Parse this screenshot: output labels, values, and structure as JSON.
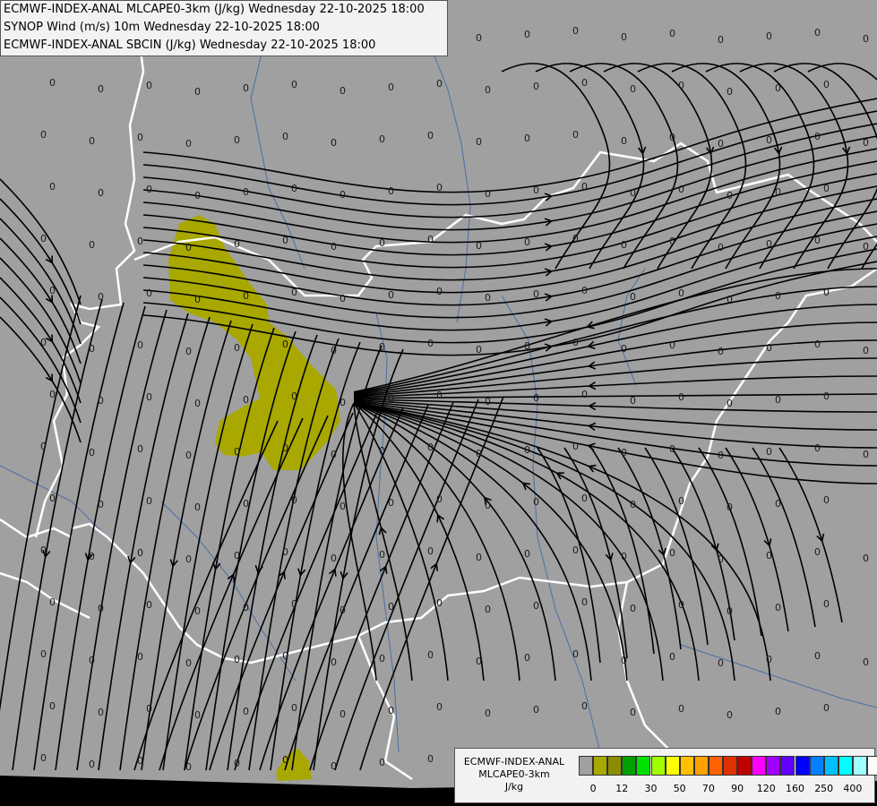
{
  "header": {
    "line1": "ECMWF-INDEX-ANAL MLCAPE0-3km (J/kg) Wednesday 22-10-2025 18:00",
    "line2": "SYNOP Wind (m/s) 10m Wednesday 22-10-2025 18:00",
    "line3": "ECMWF-INDEX-ANAL SBCIN (J/kg) Wednesday 22-10-2025 18:00"
  },
  "legend": {
    "title": "ECMWF-INDEX-ANAL",
    "subtitle": "MLCAPE0-3km",
    "unit": "J/kg",
    "colors": [
      "#a0a0a0",
      "#a8a800",
      "#8c8c00",
      "#00a000",
      "#00e000",
      "#a0ff00",
      "#ffff00",
      "#ffc000",
      "#ffa000",
      "#ff6000",
      "#e03000",
      "#c00000",
      "#ff00ff",
      "#a000ff",
      "#6000ff",
      "#0000ff",
      "#0080ff",
      "#00c0ff",
      "#00ffff",
      "#a0ffff",
      "#ffffff"
    ],
    "ticks": [
      "0",
      "12",
      "30",
      "50",
      "70",
      "90",
      "120",
      "160",
      "250",
      "400"
    ]
  },
  "map": {
    "background": "#a0a0a0",
    "cape_color": "#a8a800",
    "border_color": "#ffffff",
    "river_color": "#4a6fa5",
    "streamline_color": "#000000",
    "value_label": "0"
  }
}
